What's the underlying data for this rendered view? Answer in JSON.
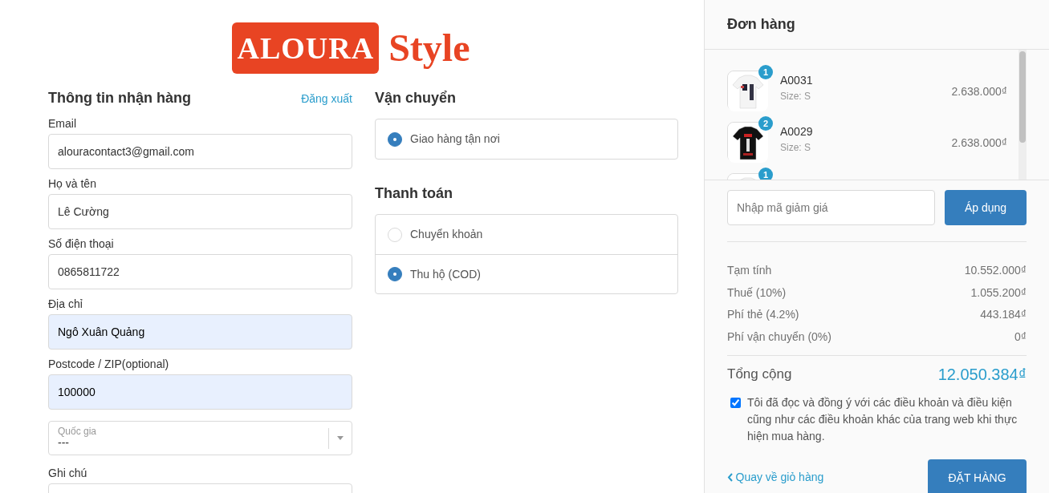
{
  "logo": {
    "boxed": "ALOURA",
    "plain": "Style"
  },
  "recipient": {
    "title": "Thông tin nhận hàng",
    "logout": "Đăng xuất",
    "fields": [
      {
        "kind": "input",
        "label": "Email",
        "value": "alouracontact3@gmail.com",
        "autofilled": false
      },
      {
        "kind": "input",
        "label": "Họ và tên",
        "value": "Lê Cường",
        "autofilled": false
      },
      {
        "kind": "input",
        "label": "Số điện thoại",
        "value": "0865811722",
        "autofilled": false
      },
      {
        "kind": "input",
        "label": "Địa chỉ",
        "value": "Ngô Xuân Quảng",
        "autofilled": true
      },
      {
        "kind": "input",
        "label": "Postcode / ZIP(optional)",
        "value": "100000",
        "autofilled": true
      },
      {
        "kind": "select",
        "label": "Quốc gia",
        "value": "---"
      },
      {
        "kind": "textarea",
        "label": "Ghi chú"
      }
    ]
  },
  "shipping": {
    "title": "Vận chuyển",
    "options": [
      {
        "label": "Giao hàng tận nơi",
        "selected": true
      }
    ]
  },
  "payment": {
    "title": "Thanh toán",
    "options": [
      {
        "label": "Chuyển khoản",
        "selected": false
      },
      {
        "label": "Thu hộ (COD)",
        "selected": true
      }
    ]
  },
  "order": {
    "title": "Đơn hàng",
    "items": [
      {
        "quantity": "1",
        "name": "A0031",
        "variant": "Size: S",
        "price": "2.638.000₫"
      },
      {
        "quantity": "2",
        "name": "A0029",
        "variant": "Size: S",
        "price": "2.638.000₫"
      },
      {
        "quantity": "1"
      }
    ],
    "discount": {
      "placeholder": "Nhập mã giảm giá",
      "button": "Áp dụng"
    },
    "summary": [
      {
        "label": "Tạm tính",
        "value": "10.552.000₫"
      },
      {
        "label": "Thuế (10%)",
        "value": "1.055.200₫"
      },
      {
        "label": "Phí thẻ (4.2%)",
        "value": "443.184₫"
      },
      {
        "label": "Phí vận chuyển (0%)",
        "value": "0₫"
      }
    ],
    "total": {
      "label": "Tổng cộng",
      "value": "12.050.384₫"
    },
    "terms": {
      "checked": true,
      "text": "Tôi đã đọc và đồng ý với các điều khoản và điều kiện cũng như các điều khoản khác của trang web khi thực hiện mua hàng."
    },
    "back_link": "Quay về giỏ hàng",
    "submit": "ĐẶT HÀNG"
  }
}
